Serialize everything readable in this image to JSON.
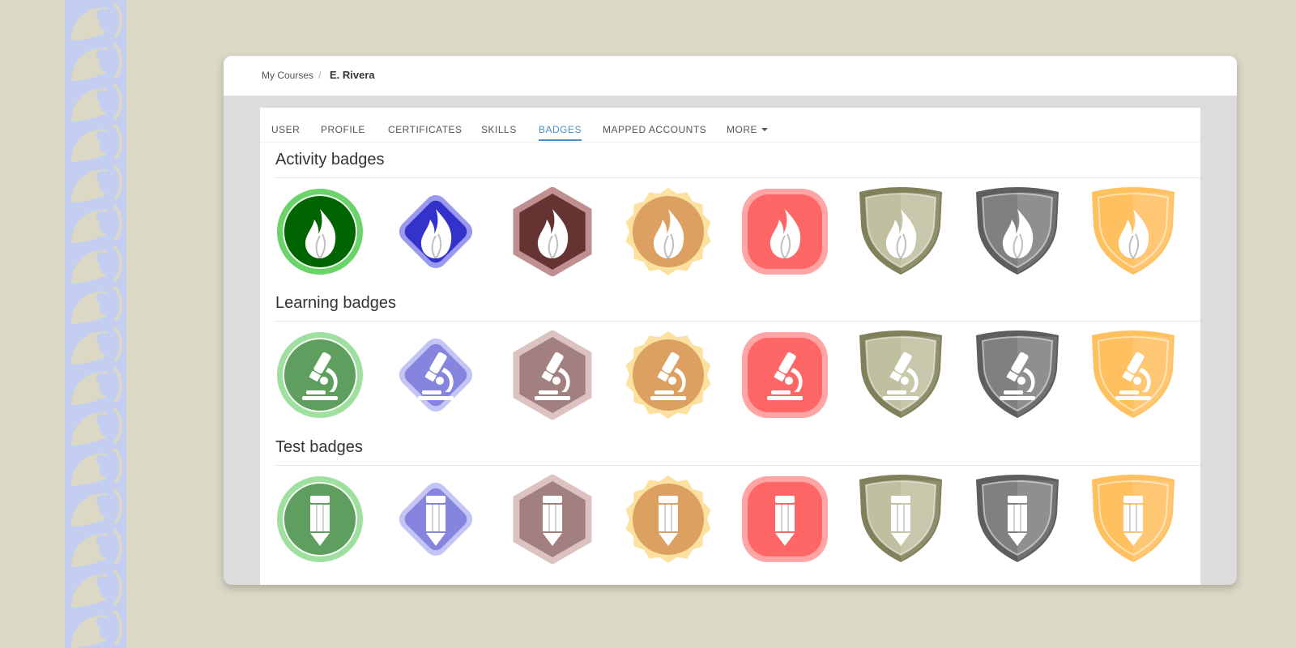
{
  "breadcrumb": {
    "parent": "My Courses",
    "separator": "/",
    "current": "E. Rivera"
  },
  "tabs": [
    {
      "label": "USER"
    },
    {
      "label": "PROFILE"
    },
    {
      "label": "CERTIFICATES"
    },
    {
      "label": "SKILLS"
    },
    {
      "label": "BADGES",
      "active": true
    },
    {
      "label": "MAPPED ACCOUNTS"
    },
    {
      "label": "MORE",
      "dropdown": true
    }
  ],
  "sections": [
    {
      "title": "Activity badges",
      "icon": "flame-icon"
    },
    {
      "title": "Learning badges",
      "icon": "microscope-icon"
    },
    {
      "title": "Test badges",
      "icon": "pencil-icon"
    }
  ],
  "badge_tiers": [
    {
      "shape": "circle",
      "colors": {
        "activity": "#006400",
        "learning": "#5e9e5e",
        "test": "#5e9e5e",
        "ring": "#6ad46a",
        "ring_light": "#9fdf9f"
      }
    },
    {
      "shape": "diamond",
      "colors": {
        "activity": "#3333cc",
        "learning": "#8585e0",
        "test": "#8585e0",
        "ring": "#9999ee",
        "ring_light": "#c5c5f5"
      }
    },
    {
      "shape": "hexagon",
      "colors": {
        "activity": "#663333",
        "learning": "#a38080",
        "test": "#a38080",
        "ring": "#c09090",
        "ring_light": "#ddc2c2"
      }
    },
    {
      "shape": "seal",
      "colors": {
        "activity": "#dca060",
        "learning": "#dca060",
        "test": "#dca060",
        "ring": "#fce1a0",
        "ring_light": "#fce1a0"
      }
    },
    {
      "shape": "rounded-square",
      "colors": {
        "activity": "#ff6666",
        "learning": "#ff6666",
        "test": "#ff6666",
        "ring": "#ffa5a5",
        "ring_light": "#ffa5a5"
      }
    },
    {
      "shape": "shield",
      "colors": {
        "activity": "#c0c0a0",
        "learning": "#c0c0a0",
        "test": "#c0c0a0",
        "ring": "#80805a",
        "ring_light": "#80805a"
      }
    },
    {
      "shape": "shield",
      "colors": {
        "activity": "#808080",
        "learning": "#808080",
        "test": "#808080",
        "ring": "#5e5e5e",
        "ring_light": "#5e5e5e"
      }
    },
    {
      "shape": "shield",
      "colors": {
        "activity": "#ffc060",
        "learning": "#ffc060",
        "test": "#ffc060",
        "ring": "#ffc060",
        "ring_light": "#ffc060"
      }
    }
  ]
}
